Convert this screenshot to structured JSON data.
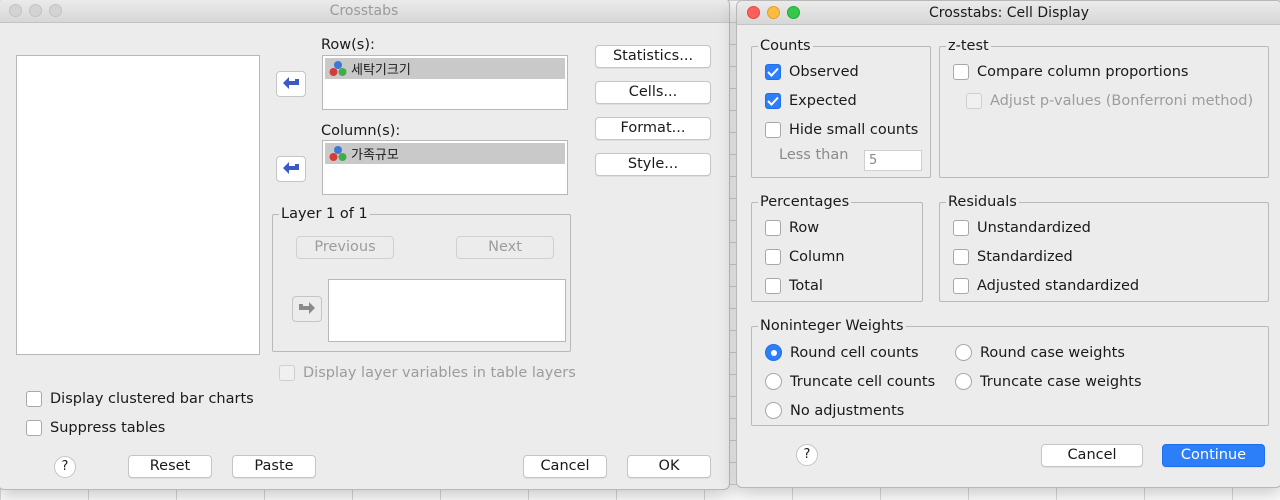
{
  "crosstabs": {
    "title": "Crosstabs",
    "rows_label": "Row(s):",
    "columns_label": "Column(s):",
    "row_variable": "세탁기크기",
    "column_variable": "가족규모",
    "layer_label": "Layer 1 of 1",
    "previous_label": "Previous",
    "next_label": "Next",
    "display_layer_vars_label": "Display layer variables in table layers",
    "clustered_bar_label": "Display clustered bar charts",
    "suppress_tables_label": "Suppress tables",
    "statistics_button": "Statistics...",
    "cells_button": "Cells...",
    "format_button": "Format...",
    "style_button": "Style...",
    "help_label": "?",
    "reset_button": "Reset",
    "paste_button": "Paste",
    "cancel_button": "Cancel",
    "ok_button": "OK"
  },
  "cell_display": {
    "title": "Crosstabs: Cell Display",
    "counts": {
      "label": "Counts",
      "observed": {
        "label": "Observed",
        "checked": true
      },
      "expected": {
        "label": "Expected",
        "checked": true
      },
      "hide_small": {
        "label": "Hide small counts",
        "checked": false
      },
      "less_than_label": "Less than",
      "less_than_value": "5"
    },
    "ztest": {
      "label": "z-test",
      "compare_label": "Compare column proportions",
      "adjust_label": "Adjust p-values (Bonferroni method)"
    },
    "percentages": {
      "label": "Percentages",
      "row": "Row",
      "column": "Column",
      "total": "Total"
    },
    "residuals": {
      "label": "Residuals",
      "unstandardized": "Unstandardized",
      "standardized": "Standardized",
      "adjusted": "Adjusted standardized"
    },
    "noninteger": {
      "label": "Noninteger Weights",
      "round_cell": "Round cell counts",
      "round_case": "Round case weights",
      "truncate_cell": "Truncate cell counts",
      "truncate_case": "Truncate case weights",
      "no_adjust": "No adjustments",
      "selected": "Round cell counts"
    },
    "help_label": "?",
    "cancel_button": "Cancel",
    "continue_button": "Continue"
  },
  "colors": {
    "accent": "#2d7ff9",
    "traffic_red": "#fc605b",
    "traffic_yellow": "#fdbc40",
    "traffic_green": "#34c84a",
    "traffic_inactive": "#d3d3d3"
  }
}
